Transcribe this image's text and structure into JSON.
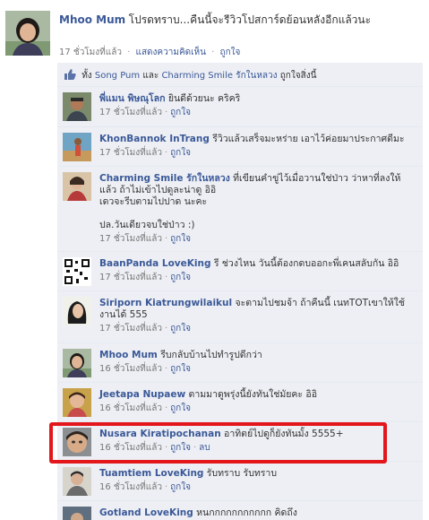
{
  "post": {
    "author": "Mhoo Mum",
    "text": "โปรดทราบ...คืนนี้จะรีวิวโปสการ์ดย้อนหลังอีกแล้วนะ",
    "time": "17 ชั่วโมงที่แล้ว",
    "comment_link": "แสดงความคิดเห็น",
    "like_link": "ถูกใจ"
  },
  "likes": {
    "prefix": "ทั้ง",
    "user1": "Song Pum",
    "and": "และ",
    "user2": "Charming Smile รักในหลวง",
    "suffix": "ถูกใจสิ่งนี้"
  },
  "comments": [
    {
      "author": "พี่แมน พิษณุโลก",
      "text": "ยินดีด้วยนะ คริคริ",
      "time": "17 ชั่วโมงที่แล้ว",
      "like": "ถูกใจ"
    },
    {
      "author": "KhonBannok InTrang",
      "text": "รีวิวแล้วเสร็จมะหร่าย เอาไว้ค่อยมาประกาศดีมะ",
      "time": "17 ชั่วโมงที่แล้ว",
      "like": "ถูกใจ"
    },
    {
      "author": "Charming Smile รักในหลวง",
      "text": "ที่เขียนคำขู่ไว้เมื่อวานใช่ป่าว ว่าหาที่ลงให้แล้ว ถ้าไม่เข้าไปดูละน่าดู อิอิ",
      "text2": "เดวจะรีบตามไปปาด นะคะ",
      "text3": "ปล.วันเดียวจบใช่ป่าว :)",
      "time": "17 ชั่วโมงที่แล้ว",
      "like": "ถูกใจ"
    },
    {
      "author": "BaanPanda LoveKing",
      "text": "รี ช่วงไหน วันนี้ต้องกดบออกะพี่เคนสลับกัน อิอิ",
      "time": "17 ชั่วโมงที่แล้ว",
      "like": "ถูกใจ"
    },
    {
      "author": "Siriporn Kiatrungwilaikul",
      "text": "จะตามไปชมจ้า ถ้าคืนนี้ เนทTOTเขาให้ใช้งานได้ 555",
      "time": "17 ชั่วโมงที่แล้ว",
      "like": "ถูกใจ"
    },
    {
      "author": "Mhoo Mum",
      "text": "รีบกลับบ้านไปทำรูปดีกว่า",
      "time": "16 ชั่วโมงที่แล้ว",
      "like": "ถูกใจ"
    },
    {
      "author": "Jeetapa Nupaew",
      "text": "ตามมาดูพรุ่งนี้ยังทันใช่มัยคะ อิอิ",
      "time": "16 ชั่วโมงที่แล้ว",
      "like": "ถูกใจ"
    },
    {
      "author": "Nusara Kiratipochanan",
      "text": "อาทิตย์ไปดูก็ยังทันมั้ง 5555+",
      "time": "16 ชั่วโมงที่แล้ว",
      "like": "ถูกใจ",
      "delete": "ลบ"
    },
    {
      "author": "Tuamtiem LoveKing",
      "text": "รับทราบ รับทราบ",
      "time": "16 ชั่วโมงที่แล้ว",
      "like": "ถูกใจ"
    },
    {
      "author": "Gotland LoveKing",
      "text": "หนกกกกกกกกกกก คิดถึง"
    }
  ],
  "colors": {
    "link": "#3b5998",
    "feedback_bg": "#edeff4",
    "highlight": "#e3161c"
  },
  "icons": [
    "thumbs-up-icon"
  ]
}
